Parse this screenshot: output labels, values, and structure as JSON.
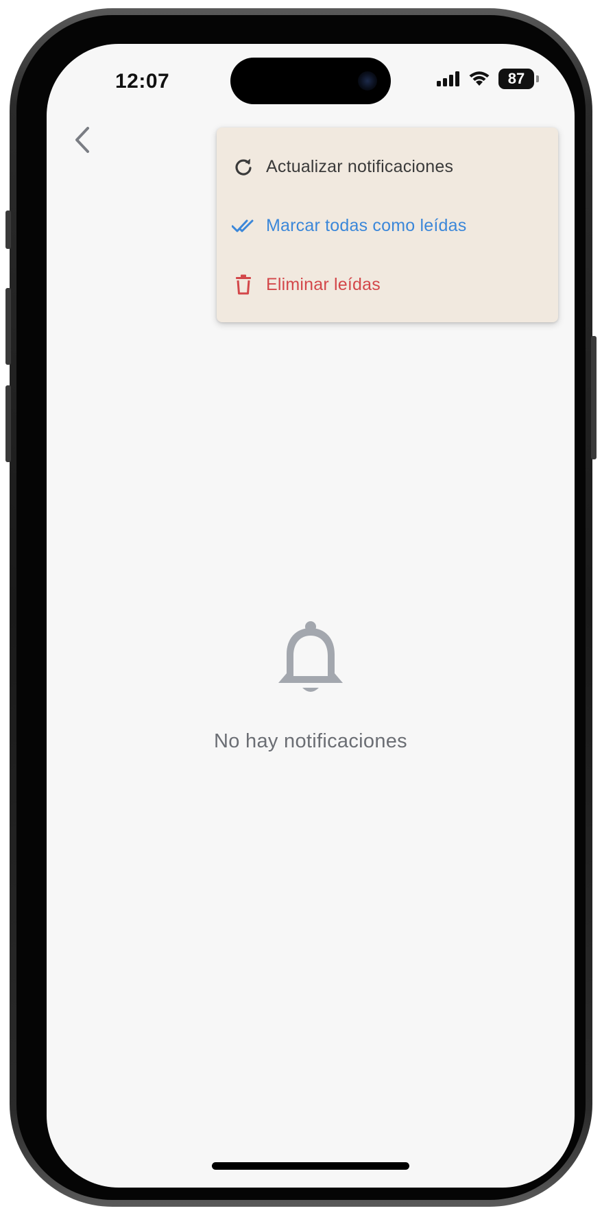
{
  "status_bar": {
    "time": "12:07",
    "battery": "87"
  },
  "menu": {
    "items": [
      {
        "label": "Actualizar notificaciones",
        "icon": "refresh-icon",
        "color": "#3a3a3a"
      },
      {
        "label": "Marcar todas como leídas",
        "icon": "double-check-icon",
        "color": "#3b87d9"
      },
      {
        "label": "Eliminar leídas",
        "icon": "trash-icon",
        "color": "#d3474a"
      }
    ]
  },
  "empty_state": {
    "icon": "bell-icon",
    "message": "No hay notificaciones"
  },
  "colors": {
    "screen_bg": "#f7f7f7",
    "menu_bg": "#f1e9df",
    "bell": "#a3a7ae",
    "back_chevron": "#7a7d83"
  }
}
